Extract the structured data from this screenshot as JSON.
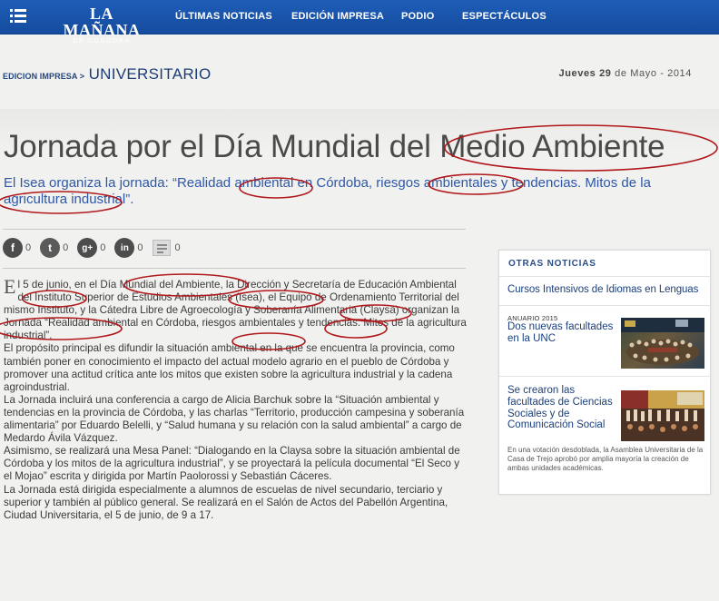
{
  "nav": {
    "logo_main": "LA MAÑANA",
    "logo_sub": "DE CÓRDOBA",
    "links": [
      "ÚLTIMAS NOTICIAS",
      "EDICIÓN IMPRESA",
      "PODIO",
      "ESPECTÁCULOS"
    ]
  },
  "section": {
    "parent": "EDICION IMPRESA >",
    "current": "UNIVERSITARIO",
    "date_day": "Jueves",
    "date_num": "29",
    "date_rest": "de Mayo - 2014"
  },
  "article": {
    "title": "Jornada por el Día Mundial del Medio Ambiente",
    "subtitle": "El Isea organiza la jornada: “Realidad ambiental en Córdoba, riesgos ambientales y tendencias. Mitos de la agricultura industrial”.",
    "drop_cap": "E",
    "paragraphs": [
      "l 5 de junio, en el Día Mundial del Ambiente, la Dirección y Secretaría de Educación Ambiental del  Instituto Superior de Estudios Ambientales (Isea), el Equipo de Ordenamiento Territorial del mismo Instituto, y la Cátedra Libre de Agroecología y Soberanía Alimentaria (Claysa) organizan la  Jornada “Realidad ambiental en Córdoba, riesgos ambientales y tendencias. Mitos de la agricultura industrial”.",
      "El  propósito principal es difundir la situación ambiental en la que se encuentra la provincia, como también poner en conocimiento el impacto del actual modelo agrario en el pueblo de Córdoba y promover una actitud crítica ante los mitos que existen sobre la agricultura industrial y la cadena agroindustrial.",
      "La Jornada incluirá una conferencia a cargo de Alicia Barchuk sobre la “Situación ambiental y tendencias en la provincia de Córdoba, y las charlas “Territorio, producción campesina y soberanía alimentaria” por Eduardo Belelli, y “Salud humana y su relación con la salud ambiental” a cargo de Medardo Ávila Vázquez.",
      "Asimismo, se realizará una Mesa Panel: “Dialogando en la Claysa sobre la situación ambiental de Córdoba y los mitos de la agricultura industrial”, y se proyectará la película documental “El Seco y el Mojao” escrita y dirigida por Martín Paolorossi y Sebastián Cáceres.",
      "La Jornada está dirigida especialmente a alumnos de escuelas de nivel secundario, terciario y  superior  y también al público general. Se realizará en el Salón de Actos del Pabellón Argentina, Ciudad Universitaria, el 5 de junio, de 9  a 17."
    ]
  },
  "social": {
    "facebook": "f",
    "twitter": "t",
    "gplus": "g+",
    "linkedin": "in",
    "counts": [
      "0",
      "0",
      "0",
      "0",
      "0"
    ]
  },
  "sidebar": {
    "heading": "OTRAS NOTICIAS",
    "item1_title": "Cursos Intensivos de Idiomas en Lenguas",
    "item2_meta": "ANUARIO 2015",
    "item2_title": "Dos nuevas facultades en la UNC",
    "item3_title": "Se crearon las facultades de Ciencias Sociales y de Comunicación Social",
    "item3_desc": "En una votación desdoblada, la Asamblea Universitaria de la Casa de Trejo aprobó por amplia mayoría la creación de ambas unidades académicas."
  },
  "colors": {
    "nav_bg": "#1a56b0",
    "link_blue": "#2e57a8",
    "annotation_red": "#b0181b"
  }
}
